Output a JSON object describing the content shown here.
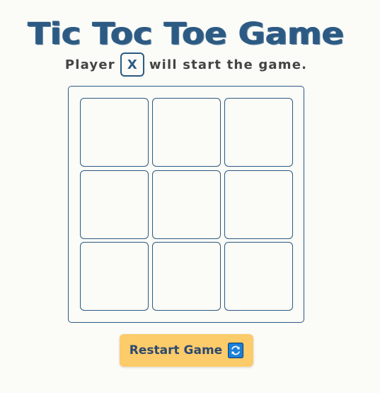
{
  "title": "Tic Toc Toe Game",
  "status": {
    "prefix": "Player",
    "current_player": "X",
    "suffix": "will start the game."
  },
  "board": {
    "cells": [
      "",
      "",
      "",
      "",
      "",
      "",
      "",
      "",
      ""
    ]
  },
  "restart_button": {
    "label": "Restart Game",
    "icon": "refresh-icon"
  },
  "colors": {
    "primary": "#2c5a82",
    "background": "#fbfbf7",
    "button": "#fccb6a",
    "text": "#444444"
  }
}
